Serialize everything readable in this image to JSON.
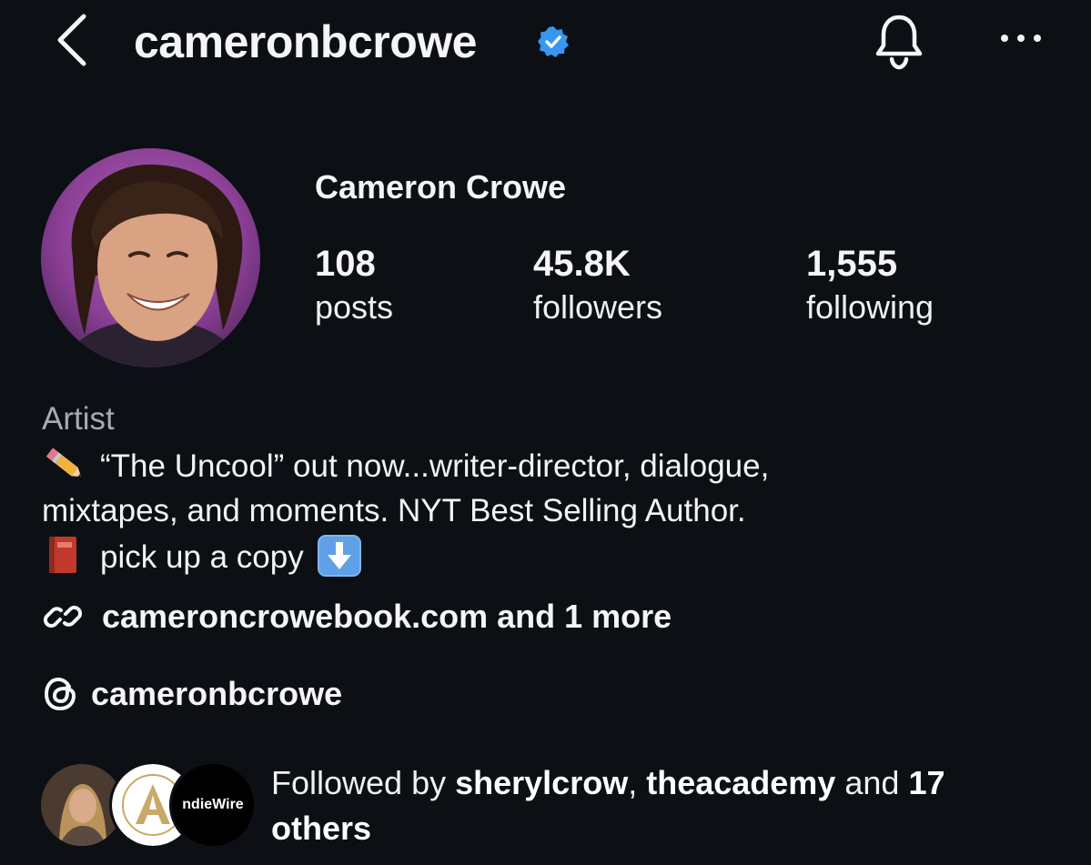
{
  "header": {
    "username": "cameronbcrowe",
    "verified": true,
    "icons": [
      "chevron-left-icon",
      "verified-badge-icon",
      "bell-icon",
      "more-dots-icon"
    ]
  },
  "profile": {
    "display_name": "Cameron Crowe",
    "stats": {
      "posts": {
        "value": "108",
        "label": "posts"
      },
      "followers": {
        "value": "45.8K",
        "label": "followers"
      },
      "following": {
        "value": "1,555",
        "label": "following"
      }
    },
    "category": "Artist",
    "bio": {
      "line1": "“The Uncool” out now...writer-director, dialogue,",
      "line2": "mixtapes, and moments. NYT Best Selling Author.",
      "line3": "pick up a copy"
    },
    "link_text": "cameroncrowebook.com and 1 more",
    "threads_handle": "cameronbcrowe"
  },
  "followed_by": {
    "prefix": "Followed by",
    "user1": "sherylcrow",
    "separator": ",",
    "user2": "theacademy",
    "middle": "and",
    "count_text": "17 others",
    "avatar3_label": "ndieWire"
  },
  "colors": {
    "background": "#0c0f14",
    "verified_blue": "#3897f0",
    "muted_text": "#a6abb2"
  }
}
